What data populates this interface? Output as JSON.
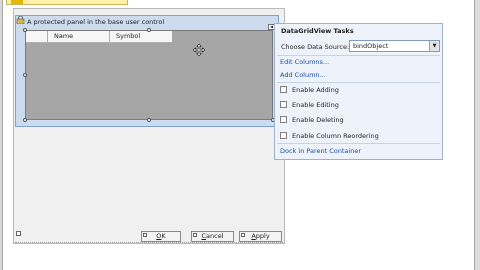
{
  "panel": {
    "label": "A protected panel in the base user control"
  },
  "grid": {
    "columns": [
      "Name",
      "Symbol"
    ]
  },
  "tasks": {
    "title": "DataGridView Tasks",
    "data_source_label": "Choose Data Source:",
    "data_source_value": "bindObject",
    "edit_columns": "Edit Columns...",
    "add_column": "Add Column...",
    "enable_adding": "Enable Adding",
    "enable_editing": "Enable Editing",
    "enable_deleting": "Enable Deleting",
    "enable_reordering": "Enable Column Reordering",
    "dock": "Dock in Parent Container"
  },
  "buttons": {
    "ok": {
      "accel": "O",
      "rest": "K"
    },
    "cancel": {
      "accel": "C",
      "rest": "ancel"
    },
    "apply": {
      "accel": "A",
      "rest": "pply"
    }
  },
  "icons": {
    "lock": "lock-icon",
    "move": "move-cursor-icon",
    "dropdown": "chevron-down-icon",
    "smart_tag": "smart-tag-arrow-icon"
  }
}
